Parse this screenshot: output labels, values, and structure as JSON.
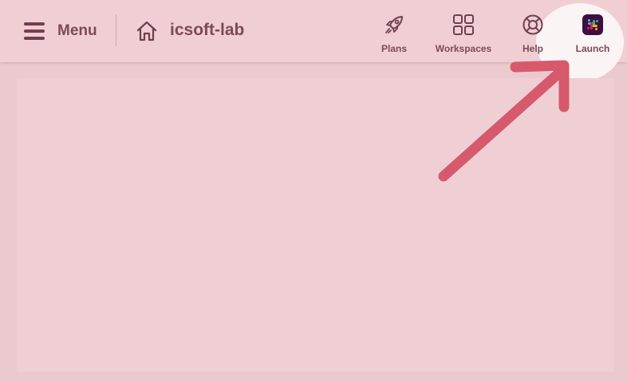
{
  "header": {
    "menu_label": "Menu",
    "workspace_name": "icsoft-lab",
    "nav": [
      {
        "label": "Plans",
        "icon": "rocket-icon"
      },
      {
        "label": "Workspaces",
        "icon": "grid-icon"
      },
      {
        "label": "Help",
        "icon": "lifebuoy-icon"
      },
      {
        "label": "Launch",
        "icon": "slack-logo-icon"
      }
    ]
  },
  "colors": {
    "background": "#ebcacf",
    "header": "#f1ced3",
    "text": "#7a4b57",
    "annotation_arrow": "#d65a6c",
    "spotlight": "#fbf4f5"
  }
}
